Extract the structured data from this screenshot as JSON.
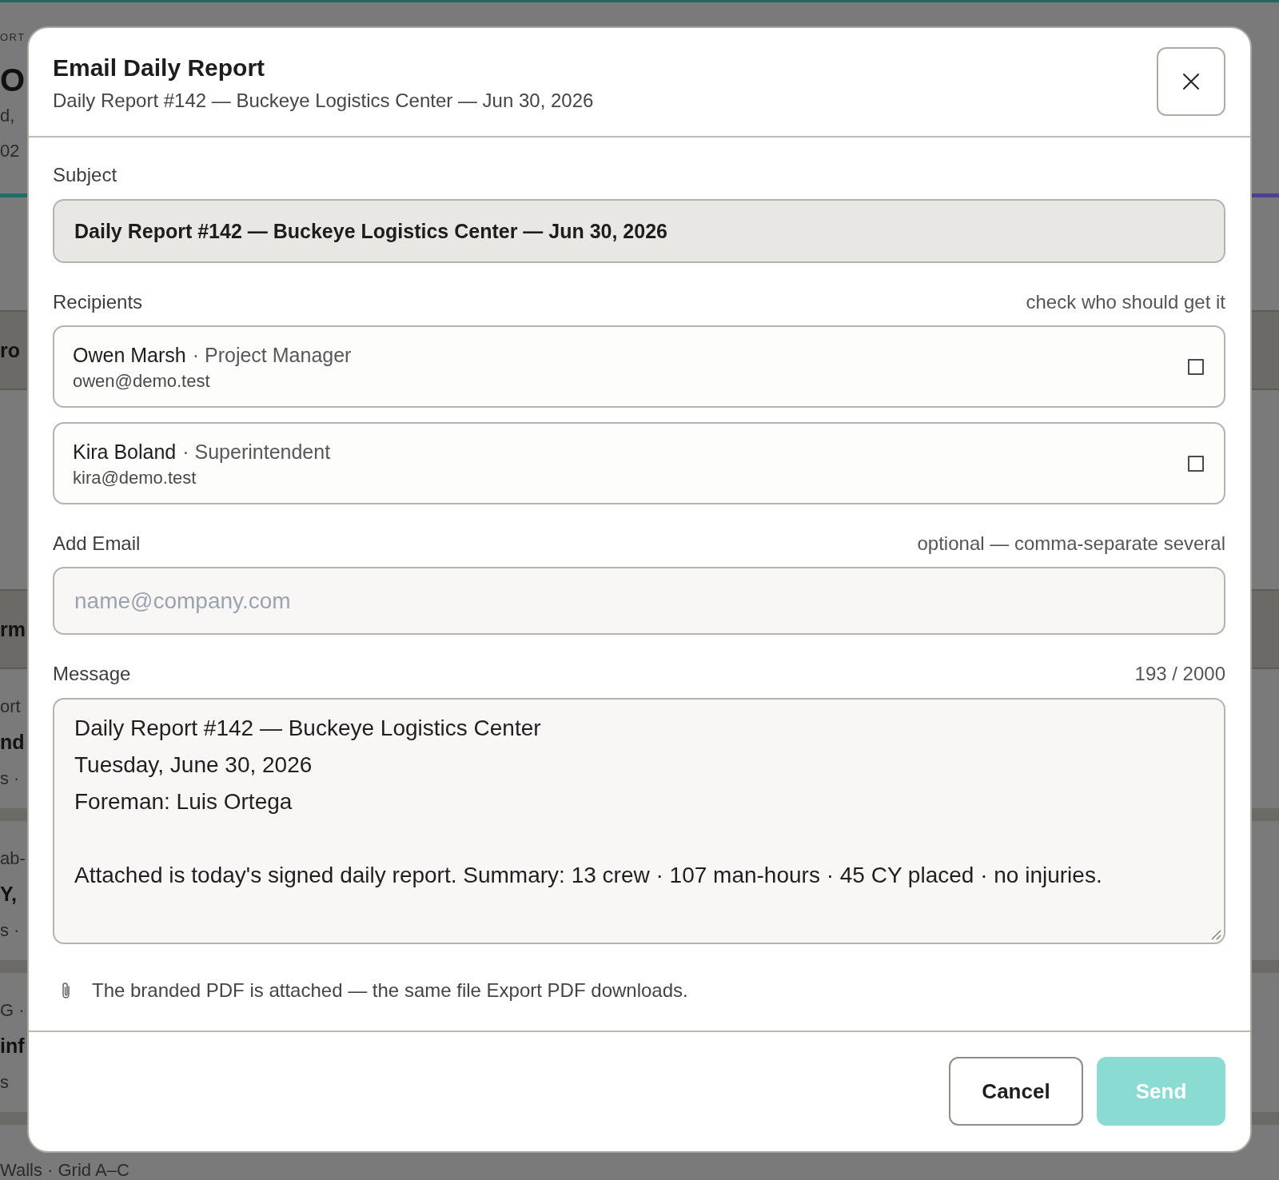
{
  "backdrop": {
    "sections": [
      {
        "kind": "header",
        "lines": [
          {
            "kind": "eyebrow",
            "text": "ORT"
          },
          {
            "kind": "figure",
            "text": "O"
          },
          {
            "kind": "meta",
            "text": "d,"
          },
          {
            "kind": "meta",
            "text": "02"
          }
        ]
      },
      {
        "kind": "band",
        "lines": [
          {
            "kind": "title",
            "text": "ro"
          }
        ]
      },
      {
        "kind": "band",
        "lines": [
          {
            "kind": "title",
            "text": "rm"
          }
        ]
      },
      {
        "kind": "item",
        "lines": [
          {
            "kind": "meta",
            "text": "ort"
          },
          {
            "kind": "title",
            "text": "nd"
          },
          {
            "kind": "meta",
            "text": "s ·"
          }
        ]
      },
      {
        "kind": "item",
        "lines": [
          {
            "kind": "meta",
            "text": "ab-"
          },
          {
            "kind": "title",
            "text": "Y,"
          },
          {
            "kind": "meta",
            "text": "s ·"
          }
        ]
      },
      {
        "kind": "item",
        "lines": [
          {
            "kind": "meta",
            "text": "G ·"
          },
          {
            "kind": "title",
            "text": "inf"
          },
          {
            "kind": "meta",
            "text": "s"
          }
        ]
      },
      {
        "kind": "item",
        "lines": [
          {
            "kind": "meta",
            "text": "Walls · Grid A–C"
          }
        ]
      }
    ]
  },
  "dialog": {
    "title": "Email Daily Report",
    "subtitle": "Daily Report #142 — Buckeye Logistics Center — Jun 30, 2026",
    "subject": {
      "label": "Subject",
      "value": "Daily Report #142 — Buckeye Logistics Center — Jun 30, 2026"
    },
    "recipients": {
      "label": "Recipients",
      "hint": "check who should get it",
      "items": [
        {
          "name": "Owen Marsh",
          "role": "· Project Manager",
          "email": "owen@demo.test",
          "checked": false
        },
        {
          "name": "Kira Boland",
          "role": "· Superintendent",
          "email": "kira@demo.test",
          "checked": false
        }
      ]
    },
    "add_email": {
      "label": "Add Email",
      "hint": "optional — comma-separate several",
      "placeholder": "name@company.com"
    },
    "message": {
      "label": "Message",
      "counter": "193 / 2000",
      "value": "Daily Report #142 — Buckeye Logistics Center\nTuesday, June 30, 2026\nForeman: Luis Ortega\n\nAttached is today's signed daily report. Summary: 13 crew · 107 man-hours · 45 CY placed · no injuries."
    },
    "attachment_note": "The branded PDF is attached — the same file Export PDF downloads.",
    "buttons": [
      {
        "kind": "secondary",
        "label": "Cancel",
        "disabled": false
      },
      {
        "kind": "primary",
        "label": "Send",
        "disabled": true
      }
    ]
  }
}
